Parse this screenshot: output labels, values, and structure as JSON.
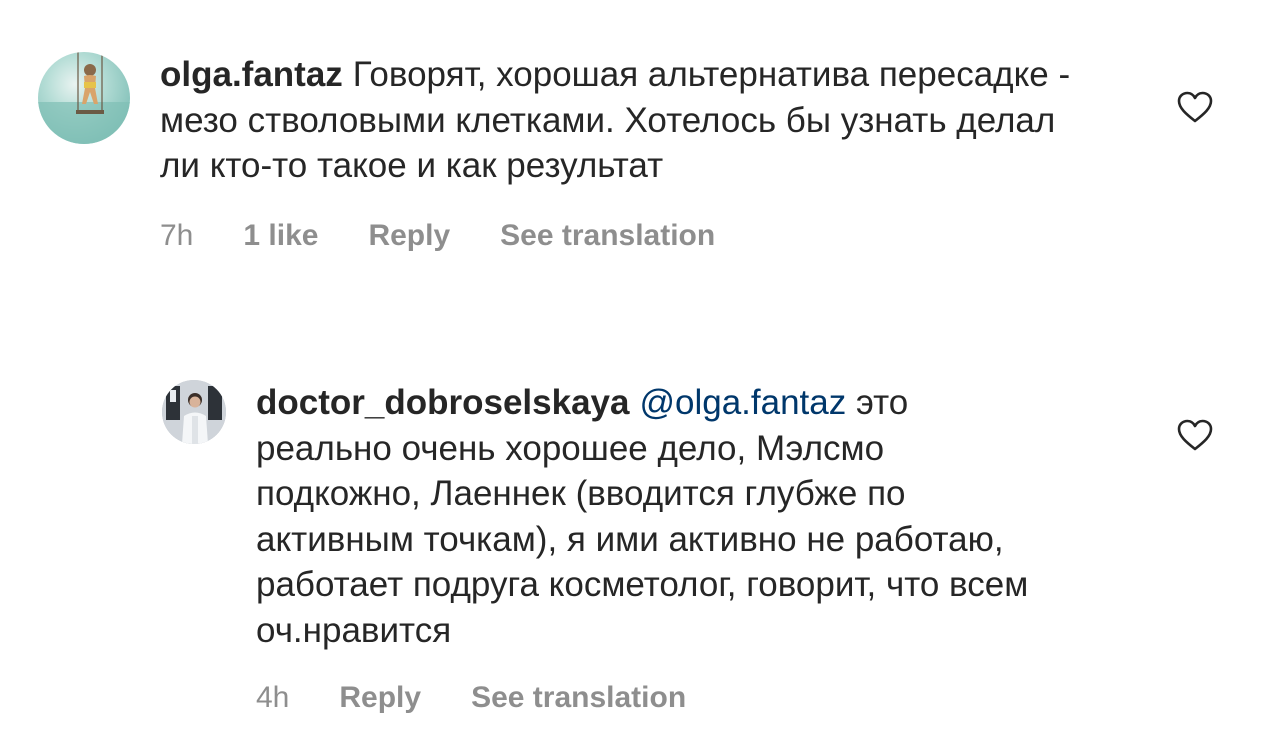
{
  "comments": [
    {
      "username": "olga.fantaz",
      "text": "Говорят, хорошая альтернатива пересадке - мезо стволовыми клетками. Хотелось бы узнать делал ли кто-то такое и как результат",
      "time": "7h",
      "likes": "1 like",
      "reply_label": "Reply",
      "translate_label": "See translation",
      "avatar_icon": "avatar-photo-beach-swing",
      "like_icon": "heart-outline-icon"
    },
    {
      "username": "doctor_dobroselskaya",
      "mention": "@olga.fantaz",
      "text": "это реально очень хорошее дело, Мэлсмо подкожно, Лаеннек (вводится глубже по активным точкам), я ими активно не работаю, работает подруга косметолог, говорит, что всем оч.нравится",
      "time": "4h",
      "reply_label": "Reply",
      "translate_label": "See translation",
      "avatar_icon": "avatar-photo-doctor",
      "like_icon": "heart-outline-icon"
    }
  ],
  "colors": {
    "text": "#262626",
    "secondary": "#8e8e8e",
    "mention": "#00376b",
    "background": "#ffffff"
  }
}
